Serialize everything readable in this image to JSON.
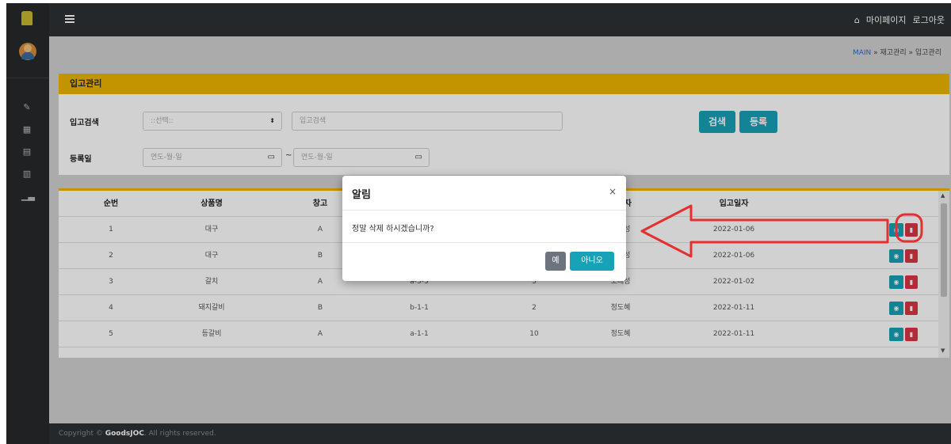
{
  "topbar": {
    "mypage": "마이페이지",
    "logout": "로그아웃"
  },
  "breadcrumb": {
    "main": "MAIN",
    "sep1": " » ",
    "inventory": "재고관리",
    "sep2": " » ",
    "incoming": "입고관리"
  },
  "panel": {
    "title": "입고관리",
    "search_label": "입고검색",
    "select_value": "::선택::",
    "search_placeholder": "입고검색",
    "search_button": "검색",
    "register_button": "등록",
    "date_label": "등록일",
    "date_from_placeholder": "연도-월-일",
    "date_tilde": "~",
    "date_to_placeholder": "연도-월-일"
  },
  "table": {
    "headers": [
      "순번",
      "상품명",
      "창고",
      "",
      "",
      "입고자",
      "입고일자"
    ],
    "rows": [
      {
        "no": "1",
        "product": "대구",
        "warehouse": "A",
        "location": "",
        "qty": "",
        "receiver": "최대성",
        "date": "2022-01-06"
      },
      {
        "no": "2",
        "product": "대구",
        "warehouse": "B",
        "location": "",
        "qty": "",
        "receiver": "최대성",
        "date": "2022-01-06"
      },
      {
        "no": "3",
        "product": "갈치",
        "warehouse": "A",
        "location": "a-3-3",
        "qty": "3",
        "receiver": "오대성",
        "date": "2022-01-02"
      },
      {
        "no": "4",
        "product": "돼지갈비",
        "warehouse": "B",
        "location": "b-1-1",
        "qty": "2",
        "receiver": "정도혜",
        "date": "2022-01-11"
      },
      {
        "no": "5",
        "product": "등갈비",
        "warehouse": "A",
        "location": "a-1-1",
        "qty": "10",
        "receiver": "정도혜",
        "date": "2022-01-11"
      }
    ]
  },
  "modal": {
    "title": "알림",
    "close": "×",
    "message": "정말 삭제 하시겠습니까?",
    "yes": "예",
    "no": "아니오"
  },
  "footer": {
    "prefix": "Copyright © ",
    "brand": "GoodsJOC",
    "suffix": ". All rights reserved."
  },
  "icons": {
    "sidebar": [
      "edit-icon",
      "warehouse-icon",
      "stack-icon",
      "boxes-icon",
      "chart-icon"
    ],
    "row_actions": [
      "eye-icon",
      "trash-icon"
    ]
  },
  "colors": {
    "accent": "#f0b400",
    "teal": "#17a2b8",
    "danger": "#dc3545",
    "annotation": "#e53030"
  }
}
